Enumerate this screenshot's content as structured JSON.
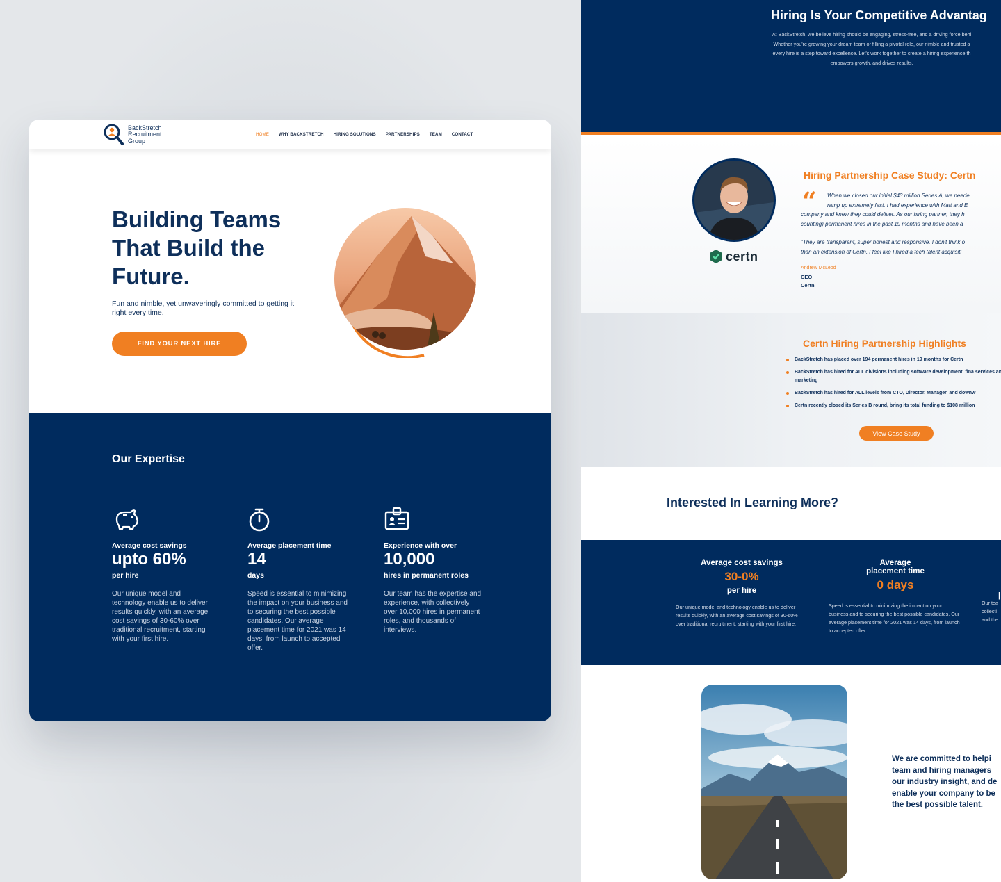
{
  "colors": {
    "navy": "#002b5e",
    "orange": "#f07f22",
    "text_dark": "#0e2f5a"
  },
  "left_card": {
    "logo": {
      "icon": "magnifier-person-icon",
      "line1": "BackStretch",
      "line2": "Recruitment",
      "line3": "Group"
    },
    "nav": [
      {
        "label": "HOME",
        "active": true
      },
      {
        "label": "WHY BACKSTRETCH",
        "active": false
      },
      {
        "label": "HIRING SOLUTIONS",
        "active": false
      },
      {
        "label": "PARTNERSHIPS",
        "active": false
      },
      {
        "label": "TEAM",
        "active": false
      },
      {
        "label": "CONTACT",
        "active": false
      }
    ],
    "hero": {
      "title_line1": "Building Teams",
      "title_line2": "That Build the",
      "title_line3": "Future.",
      "subtitle": "Fun and nimble, yet unwaveringly committed to getting it right every time.",
      "cta": "FIND YOUR NEXT HIRE"
    },
    "expertise": {
      "title": "Our Expertise",
      "items": [
        {
          "icon": "piggy-bank-icon",
          "label": "Average cost savings",
          "value": "upto 60%",
          "unit": "per hire",
          "description": "Our unique model and technology enable us to deliver results quickly, with an average cost savings of 30-60% over traditional recruitment, starting with your first hire."
        },
        {
          "icon": "stopwatch-icon",
          "label": "Average placement time",
          "value": "14",
          "unit": "days",
          "description": "Speed is essential to minimizing the impact on your business and to securing the best possible candidates. Our average placement time for 2021 was 14 days, from launch to accepted offer."
        },
        {
          "icon": "id-badge-icon",
          "label": "Experience with over",
          "value": "10,000",
          "unit": "hires in permanent roles",
          "description": "Our team has the expertise and experience, with collectively over 10,000 hires in permanent roles, and thousands of interviews."
        }
      ]
    }
  },
  "right_panel": {
    "top": {
      "title": "Hiring Is Your Competitive Advantag",
      "body_line1": "At BackStretch, we believe hiring should be engaging, stress-free, and a driving force behi",
      "body_line2": "Whether you're growing your dream team or filling a pivotal role, our nimble and trusted a",
      "body_line3": "every hire is a step toward excellence. Let's work together to create a hiring experience th",
      "body_line4": "empowers growth, and drives results."
    },
    "case_study": {
      "title": "Hiring Partnership Case Study: Certn",
      "company_logo": "certn",
      "quote_line1": "When we closed our initial $43 million Series A, we neede",
      "quote_line2": "ramp up extremely fast. I had experience with Matt and E",
      "quote_line3": "company and knew they could deliver. As our hiring partner, they h",
      "quote_line4": "counting) permanent hires in the past 19 months and have been a",
      "quote2_line1": "\"They are transparent, super honest and responsive. I don't think o",
      "quote2_line2": "than an extension of Certn. I feel like I hired a tech talent acquisiti",
      "person": "Andrew McLeod",
      "role": "CEO",
      "company": "Certn"
    },
    "highlights": {
      "title": "Certn Hiring Partnership Highlights",
      "items": [
        "BackStretch has placed over 194 permanent hires in 19 months for Certn",
        "BackStretch has hired for ALL divisions including software development, fina services and marketing",
        "BackStretch has hired for ALL levels from CTO, Director, Manager, and downw",
        "Certn recently closed its Series B round, bring its total funding to $108 million"
      ],
      "button": "View Case Study"
    },
    "learn_more": "Interested In Learning More?",
    "stats": [
      {
        "label": "Average cost savings",
        "value": "30-0%",
        "unit": "per hire",
        "description": "Our unique model and technology enable us to deliver results quickly, with an average cost savings of 30-60% over traditional recruitment, starting with your first hire."
      },
      {
        "label_line1": "Average",
        "label_line2": "placement time",
        "value": "0 days",
        "description": "Speed is essential to minimizing the impact on your business and to securing the best possible candidates. Our average placement time for 2021 was 14 days, from launch to accepted offer."
      }
    ],
    "stats_cut": {
      "line1": "Our tea",
      "line2": "collecti",
      "line3": "and the"
    },
    "commitment": {
      "line1": "We are committed to helpi",
      "line2": "team and hiring managers",
      "line3": "our industry insight, and de",
      "line4": "enable your company to be",
      "line5": "the best possible talent."
    }
  }
}
